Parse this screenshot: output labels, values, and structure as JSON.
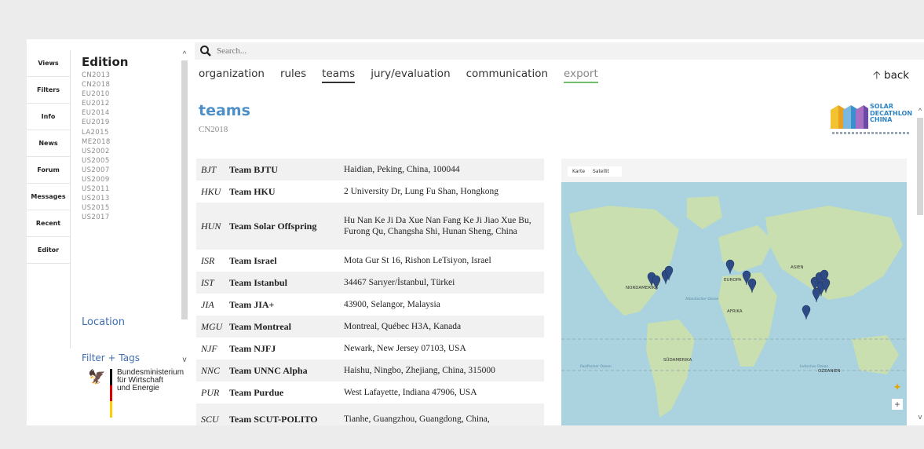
{
  "rail": [
    "Views",
    "Filters",
    "Info",
    "News",
    "Forum",
    "Messages",
    "Recent",
    "Editor"
  ],
  "editions": {
    "title": "Edition",
    "items": [
      "CN2013",
      "CN2018",
      "EU2010",
      "EU2012",
      "EU2014",
      "EU2019",
      "LA2015",
      "ME2018",
      "US2002",
      "US2005",
      "US2007",
      "US2009",
      "US2011",
      "US2013",
      "US2015",
      "US2017"
    ]
  },
  "location_title": "Location",
  "filter_title": "Filter + Tags",
  "ministry": {
    "lines": [
      "Bundesministerium",
      "für Wirtschaft",
      "und Energie"
    ]
  },
  "search": {
    "placeholder": "Search..."
  },
  "tabs": [
    "organization",
    "rules",
    "teams",
    "jury/evaluation",
    "communication",
    "export"
  ],
  "back_label": "back",
  "page": {
    "title": "teams",
    "subtitle": "CN2018"
  },
  "logo": {
    "lines": [
      "SOLAR",
      "DECATHLON",
      "CHINA"
    ]
  },
  "teams": [
    {
      "code": "BJT",
      "name": "Team BJTU",
      "address": "Haidian, Peking, China, 100044"
    },
    {
      "code": "HKU",
      "name": "Team HKU",
      "address": "2 University Dr, Lung Fu Shan, Hongkong"
    },
    {
      "code": "HUN",
      "name": "Team Solar Offspring",
      "address": "Hu Nan Ke Ji Da Xue Nan Fang Ke Ji Jiao Xue Bu, Furong Qu, Changsha Shi, Hunan Sheng, China"
    },
    {
      "code": "ISR",
      "name": "Team Israel",
      "address": "Mota Gur St 16, Rishon LeTsiyon, Israel"
    },
    {
      "code": "IST",
      "name": "Team Istanbul",
      "address": "34467 Sarıyer/İstanbul, Türkei"
    },
    {
      "code": "JIA",
      "name": "Team JIA+",
      "address": "43900, Selangor, Malaysia"
    },
    {
      "code": "MGU",
      "name": "Team Montreal",
      "address": "Montreal, Québec H3A, Kanada"
    },
    {
      "code": "NJF",
      "name": "Team NJFJ",
      "address": "Newark, New Jersey 07103, USA"
    },
    {
      "code": "NNC",
      "name": "Team UNNC Alpha",
      "address": "Haishu, Ningbo, Zhejiang, China, 315000"
    },
    {
      "code": "PUR",
      "name": "Team Purdue",
      "address": "West Lafayette, Indiana 47906, USA"
    },
    {
      "code": "SCU",
      "name": "Team SCUT-POLITO",
      "address": "Tianhe, Guangzhou, Guangdong, China,"
    }
  ],
  "map": {
    "tabs": [
      "Karte",
      "Satellit"
    ],
    "labels": [
      "NORDAMERIKA",
      "EUROPA",
      "ASIEN",
      "AFRIKA",
      "Atlantischer Ozean",
      "SÜDAMERIKA",
      "Pazifischer Ozean",
      "Indischer Ozean",
      "OZEANIEN"
    ]
  },
  "colors": {
    "accent": "#4f8fc8",
    "export_underline": "#6fbf6a",
    "water": "#aad3df",
    "land": "#c9dfb0",
    "marker": "#2f4b86"
  },
  "icons": {
    "search": "search-icon",
    "back": "arrow-up-icon",
    "pegman": "pegman-icon",
    "zoom_in": "plus-icon"
  }
}
